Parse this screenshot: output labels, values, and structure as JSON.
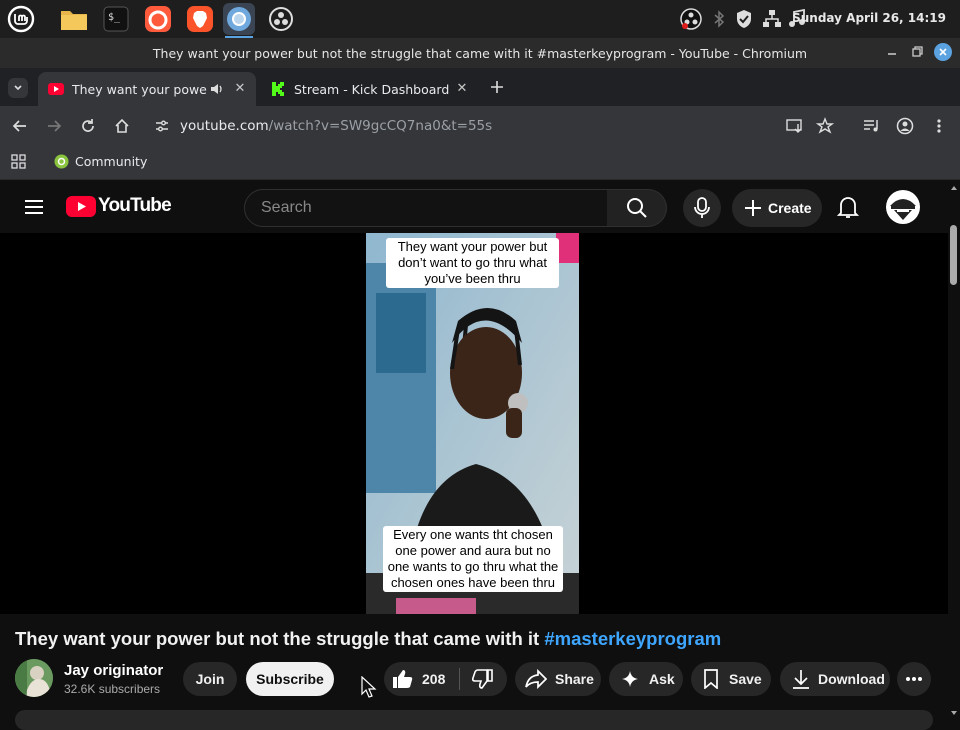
{
  "os": {
    "clock": "Sunday April 26, 14:19",
    "apps": [
      "mint-menu",
      "files",
      "terminal",
      "firefox",
      "brave",
      "chromium",
      "obs"
    ]
  },
  "window": {
    "title": "They want your power but not the struggle that came with it #masterkeyprogram - YouTube - Chromium"
  },
  "tabs": [
    {
      "label": "They want your power bu",
      "active": true,
      "audio": true
    },
    {
      "label": "Stream - Kick Dashboard",
      "active": false
    }
  ],
  "address_bar": {
    "host": "youtube.com",
    "path": "/watch?v=SW9gcCQ7na0&t=55s"
  },
  "bookmarks": [
    {
      "label": "Community"
    }
  ],
  "youtube": {
    "logo_text": "YouTube",
    "search_placeholder": "Search",
    "create_label": "Create"
  },
  "video": {
    "caption_top": "They want your power but don’t want to go thru what you’ve been thru",
    "caption_bottom": "Every one wants tht chosen one power and aura but no one wants to go thru what the chosen ones have been thru",
    "title_main": "They want your power but not the struggle that came with it ",
    "title_hashtag": "#masterkeyprogram"
  },
  "channel": {
    "name": "Jay originator",
    "subscribers": "32.6K subscribers"
  },
  "actions": {
    "join": "Join",
    "subscribe": "Subscribe",
    "likes": "208",
    "share": "Share",
    "ask": "Ask",
    "save": "Save",
    "download": "Download"
  },
  "colors": {
    "youtube_red": "#ff0033",
    "hashtag_blue": "#3ea6ff",
    "background": "#0f0f0f"
  }
}
